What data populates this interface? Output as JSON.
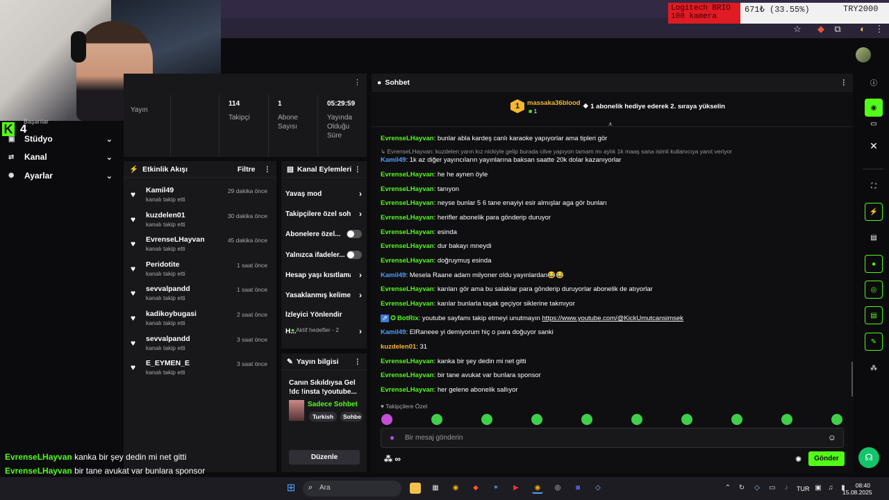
{
  "ticker": {
    "product": "Logitech BRIO 100 kamera",
    "percent": "671₺ (33.55%)",
    "currency": "TRY2000"
  },
  "webcam": {
    "badge_num": "4",
    "badge_letter": "K",
    "overlap_label": "Başarılar"
  },
  "nav": [
    {
      "label": "Stüdyo",
      "icon": "studio-icon"
    },
    {
      "label": "Kanal",
      "icon": "channel-icon"
    },
    {
      "label": "Ayarlar",
      "icon": "settings-icon"
    }
  ],
  "stats": [
    {
      "value": "",
      "label": "Yayın"
    },
    {
      "value": "",
      "label": ""
    },
    {
      "value": "114",
      "label": "Takipçi"
    },
    {
      "value": "1",
      "label": "Abone Sayısı"
    },
    {
      "value": "05:29:59",
      "label": "Yayında Olduğu Süre"
    }
  ],
  "activity": {
    "title": "Etkinlik Akışı",
    "filter": "Filtre",
    "items": [
      {
        "name": "Kamil49",
        "sub": "kanalı takip etti",
        "time": "29 dakika önce"
      },
      {
        "name": "kuzdelen01",
        "sub": "kanalı takip etti",
        "time": "30 dakika önce"
      },
      {
        "name": "EvrenseLHayvan",
        "sub": "kanalı takip etti",
        "time": "45 dakika önce"
      },
      {
        "name": "Peridotite",
        "sub": "kanalı takip etti",
        "time": "1 saat önce"
      },
      {
        "name": "sevvalpandd",
        "sub": "kanalı takip etti",
        "time": "1 saat önce"
      },
      {
        "name": "kadikoybugasi",
        "sub": "kanalı takip etti",
        "time": "2 saat önce"
      },
      {
        "name": "sevvalpandd",
        "sub": "kanalı takip etti",
        "time": "3 saat önce"
      },
      {
        "name": "E_EYMEN_E",
        "sub": "kanalı takip etti",
        "time": "3 saat önce"
      }
    ]
  },
  "channel_actions": {
    "title": "Kanal Eylemleri",
    "rows": [
      {
        "label": "Yavaş mod",
        "kind": "chevron"
      },
      {
        "label": "Takipçilere özel sohb",
        "kind": "chevron"
      },
      {
        "label": "Abonelere özel...",
        "kind": "toggle"
      },
      {
        "label": "Yalnızca ifadeler...",
        "kind": "toggle"
      },
      {
        "label": "Hesap yaşı kısıtlama",
        "kind": "chevron"
      },
      {
        "label": "Yasaklanmış kelimele",
        "kind": "chevron"
      },
      {
        "label": "İzleyici Yönlendir",
        "kind": "none"
      },
      {
        "label": "H...",
        "kind": "chevron"
      }
    ],
    "active_goals": "Aktif hedefler - 2"
  },
  "stream_info": {
    "title": "Yayın bilgisi",
    "stream_title": "Canın Sıkıldıysa Gel !dc !insta !youtube...",
    "category": "Sadece Sohbet",
    "tags": [
      "Turkish",
      "Sohbe"
    ],
    "edit": "Düzenle"
  },
  "chat": {
    "title": "Sohbet",
    "pinned_user": "massaka36blood",
    "pinned_count": "1",
    "pinned_rank": "1",
    "pinned_text": "1 abonelik hediye ederek 2. sıraya yükselin",
    "messages": [
      {
        "user": "EvrenseLHayvan",
        "color": "green",
        "text": "bunlar abla kardeş canlı karaoke yapıyorlar ama tipleri gör"
      },
      {
        "user": "",
        "color": "reply",
        "text": "EvrenseLHayvan: kuzdelen yarın kız nickiyle gelip burada cilve yapıyon tamam mı aylık 1k maaş sana isimli kullanıcıya yanıt veriyor"
      },
      {
        "user": "Kamil49",
        "color": "blue",
        "text": "1k az diğer yayıncıların yayınlarına baksan saatte 20k dolar kazanıyorlar"
      },
      {
        "user": "EvrenseLHayvan",
        "color": "green",
        "text": "he he aynen öyle"
      },
      {
        "user": "EvrenseLHayvan",
        "color": "green",
        "text": "tanıyon"
      },
      {
        "user": "EvrenseLHayvan",
        "color": "green",
        "text": "neyse bunlar 5 6 tane enayiyi esir almışlar aga gör bunları"
      },
      {
        "user": "EvrenseLHayvan",
        "color": "green",
        "text": "herifler abonelik para gönderip duruyor"
      },
      {
        "user": "EvrenseLHayvan",
        "color": "green",
        "text": "esinda"
      },
      {
        "user": "EvrenseLHayvan",
        "color": "green",
        "text": "dur bakayı mneydi"
      },
      {
        "user": "EvrenseLHayvan",
        "color": "green",
        "text": "doğruymuş esinda"
      },
      {
        "user": "Kamil49",
        "color": "blue",
        "text": "Mesela Raane adam milyoner oldu yayınlardan😂😂"
      },
      {
        "user": "EvrenseLHayvan",
        "color": "green",
        "text": "karıları gör ama bu salaklar para gönderip duruyorlar abonelik de atıyorlar"
      },
      {
        "user": "EvrenseLHayvan",
        "color": "green",
        "text": "karılar bunlarla taşak geçiyor siklerine takmıyor"
      },
      {
        "user": "BotRix",
        "color": "green",
        "text": "youtube sayfamı takip etmeyi unutmayın ",
        "link": "https://www.youtube.com/@KickUmutcansimsek"
      },
      {
        "user": "Kamil49",
        "color": "blue",
        "text": "ElRaneee yi demiyorum hiç o para doğuyor sanki"
      },
      {
        "user": "kuzdelen01",
        "color": "orange",
        "text": "31"
      },
      {
        "user": "EvrenseLHayvan",
        "color": "green",
        "text": "kanka bir şey dedin mi net gitti"
      },
      {
        "user": "EvrenseLHayvan",
        "color": "green",
        "text": "bir tane avukat var bunlara sponsor"
      },
      {
        "user": "EvrenseLHayvan",
        "color": "green",
        "text": "her gelene abonelik sallıyor"
      }
    ],
    "followers_only": "Takipçilere Özel",
    "input_placeholder": "Bir mesaj gönderin",
    "send": "Gönder"
  },
  "overlay": [
    {
      "user": "EvrenseLHayvan",
      "text": "kanka bir şey dedin mi net gitti"
    },
    {
      "user": "EvrenseLHayvan",
      "text": "bir tane avukat var bunlara sponsor"
    },
    {
      "user": "EvrenseLHayvan",
      "text": "her gelene abonelik sallıyor"
    }
  ],
  "taskbar": {
    "search": "Ara",
    "lang": "TUR",
    "time": "08:40",
    "date": "15.08.2025"
  },
  "colors": {
    "accent": "#53fc18",
    "bg": "#0b0b0d",
    "panel": "#18181b"
  }
}
